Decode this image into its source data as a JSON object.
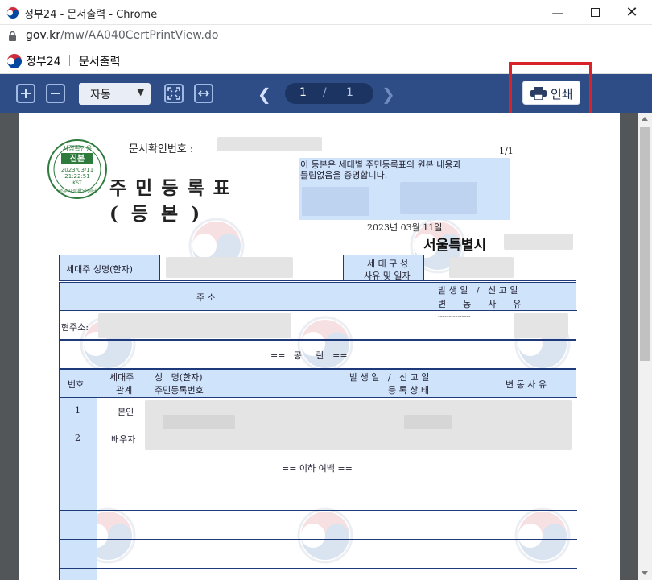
{
  "window": {
    "title": "정부24 - 문서출력 - Chrome",
    "minimize_icon": "minimize-icon",
    "maximize_icon": "maximize-icon",
    "close_icon": "close-icon"
  },
  "address_bar": {
    "host": "gov.kr",
    "path": "/mw/AA040CertPrintView.do"
  },
  "site": {
    "name": "정부24",
    "page": "문서출력"
  },
  "toolbar": {
    "zoom_value": "자동",
    "current_page": "1",
    "page_separator": "/",
    "total_pages": "1",
    "print_label": "인쇄"
  },
  "document": {
    "doc_no_label": "문서확인번호 :",
    "page_count": "1/1",
    "title": "주민등록표",
    "subtitle": "( 등    본 )",
    "certification": "이 등본은 세대별 주민등록표의 원본 내용과\n틀림없음을 증명합니다.",
    "issue_date": "2023년 03월 11일",
    "issuer": "서울특별시",
    "seal": {
      "top_text": "시점확인용",
      "center": "진본",
      "date": "2023/03/11",
      "time": "21:22:51",
      "tz": "KST",
      "bottom_text": "정부시점확인센터"
    },
    "table1": {
      "head_name_label": "세대주 성명(한자)",
      "household_label_1": "세 대 구 성",
      "household_label_2": "사유 및 일자"
    },
    "table2": {
      "address_col": "주                    소",
      "date_col_1": "발 생 일   /   신 고 일",
      "date_col_2": "변      동      사      유",
      "current_address_label": "현주소:",
      "dashes": "---------------"
    },
    "table3": {
      "blank_label": "==   공     란   =="
    },
    "table4": {
      "col_no": "번호",
      "col_rel_1": "세대주",
      "col_rel_2": "관계",
      "col_name_1": "성   명(한자)",
      "col_name_2": "주민등록번호",
      "col_date": "발 생 일   /   신 고 일",
      "col_status": "등 록 상 태",
      "col_reason": "변 동 사 유",
      "rows": [
        {
          "no": "1",
          "relation": "본인"
        },
        {
          "no": "2",
          "relation": "배우자"
        }
      ],
      "end_label": "== 이하 여백 =="
    }
  }
}
